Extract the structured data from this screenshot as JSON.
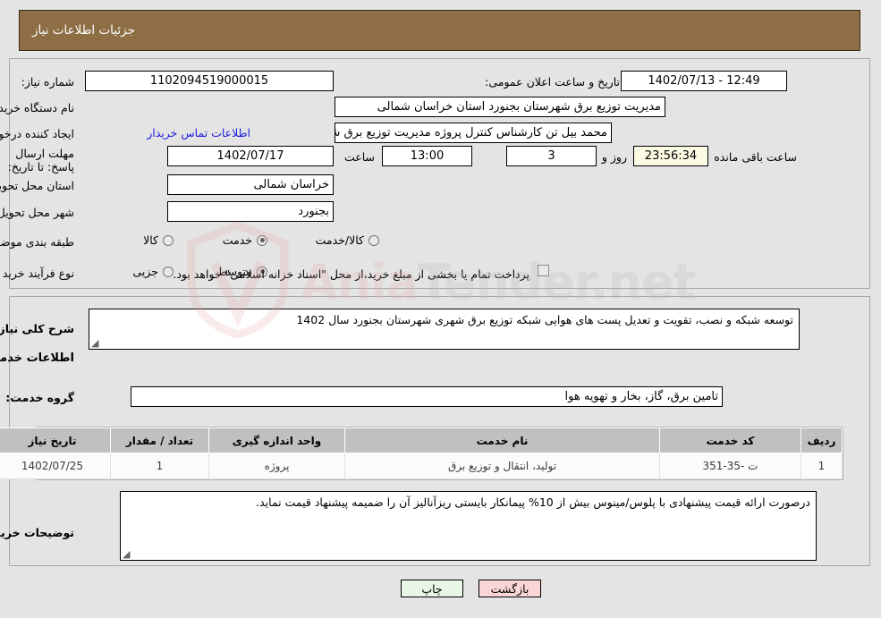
{
  "header": {
    "title": "جزئیات اطلاعات نیاز"
  },
  "watermark": {
    "text_left": "Ania",
    "text_right": "Tender.net",
    "shield_icon": "shield-icon"
  },
  "top_form": {
    "need_number_label": "شماره نیاز:",
    "need_number_value": "1102094519000015",
    "public_announce_label": "تاریخ و ساعت اعلان عمومی:",
    "public_announce_value": "1402/07/13 - 12:49",
    "buyer_org_label": "نام دستگاه خریدار:",
    "buyer_org_value": "مدیریت توزیع برق شهرستان بجنورد استان خراسان شمالی",
    "requester_label": "ایجاد کننده درخواست:",
    "requester_value": "محمد بیل تن   کارشناس کنترل پروژه مدیریت توزیع برق شهرستان بجنورد استان",
    "buyer_contact_link": "اطلاعات تماس خریدار",
    "deadline_label": "مهلت ارسال پاسخ: تا تاریخ:",
    "deadline_date": "1402/07/17",
    "hour_label": "ساعت",
    "deadline_time": "13:00",
    "days_remaining": "3",
    "days_word": "روز و",
    "time_remaining": "23:56:34",
    "hours_remaining_label": "ساعت باقی مانده",
    "province_label": "استان محل تحویل:",
    "province_value": "خراسان شمالی",
    "city_label": "شهر محل تحویل:",
    "city_value": "بجنورد",
    "category_label": "طبقه بندی موضوعی:",
    "category_options": [
      {
        "label": "کالا",
        "selected": false
      },
      {
        "label": "خدمت",
        "selected": true
      },
      {
        "label": "کالا/خدمت",
        "selected": false
      }
    ],
    "process_label": "نوع فرآیند خرید :",
    "process_options": [
      {
        "label": "جزیی",
        "selected": false
      },
      {
        "label": "متوسط",
        "selected": true
      }
    ],
    "treasury_checkbox_checked": false,
    "treasury_note": "پرداخت تمام یا بخشی از مبلغ خرید،از محل \"اسناد خزانه اسلامی\" خواهد بود."
  },
  "mid_form": {
    "general_desc_label": "شرح کلی نیاز:",
    "general_desc_value": "توسعه شبکه و نصب، تقویت و تعدیل پست های هوایی شبکه توزیع برق شهری شهرستان بجنورد سال 1402",
    "services_section_title": "اطلاعات خدمات مورد نیاز",
    "service_group_label": "گروه خدمت:",
    "service_group_value": "تامین برق، گاز، بخار و تهویه هوا",
    "buyer_notes_label": "توضیحات خریدار:",
    "buyer_notes_value": "درصورت ارائه قیمت پیشنهادی با پلوس/مینوس بیش از 10% پیمانکار بایستی ریزآنالیز آن را ضمیمه پیشنهاد قیمت نماید."
  },
  "table": {
    "columns": [
      "ردیف",
      "کد خدمت",
      "نام خدمت",
      "واحد اندازه گیری",
      "تعداد / مقدار",
      "تاریخ نیاز"
    ],
    "rows": [
      {
        "row_no": "1",
        "service_code": "ت -35-351",
        "service_name": "تولید، انتقال و توزیع برق",
        "unit": "پروژه",
        "quantity": "1",
        "need_date": "1402/07/25"
      }
    ]
  },
  "footer": {
    "print_label": "چاپ",
    "back_label": "بازگشت"
  },
  "colors": {
    "header_brown": "#8d6e45",
    "page_gray": "#e4e4e4",
    "link_blue": "#2020dd",
    "table_header_gray": "#c0c0c0",
    "countdown_bg": "#fbfbe4",
    "print_btn_bg": "#e8f6e8",
    "back_btn_bg": "#fbd6d6"
  }
}
